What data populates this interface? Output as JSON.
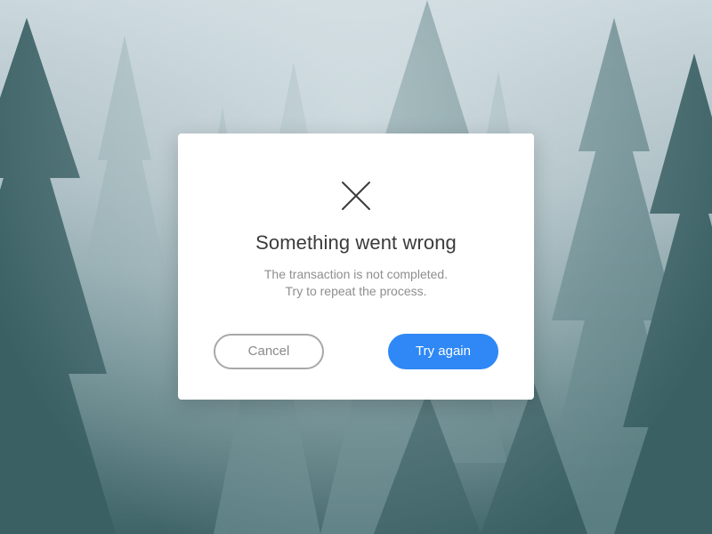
{
  "dialog": {
    "icon": "close-x-icon",
    "title": "Something went wrong",
    "message_lines": [
      "The transaction is not completed.",
      "Try to repeat the process."
    ],
    "cancel_label": "Cancel",
    "retry_label": "Try again"
  },
  "colors": {
    "primary": "#2f88f5",
    "cancel_border": "#a8a8a8",
    "title_text": "#3b3b3b",
    "message_text": "#8e8e8e",
    "background_forest": "#3f6468",
    "background_fog": "#c9d6db"
  }
}
